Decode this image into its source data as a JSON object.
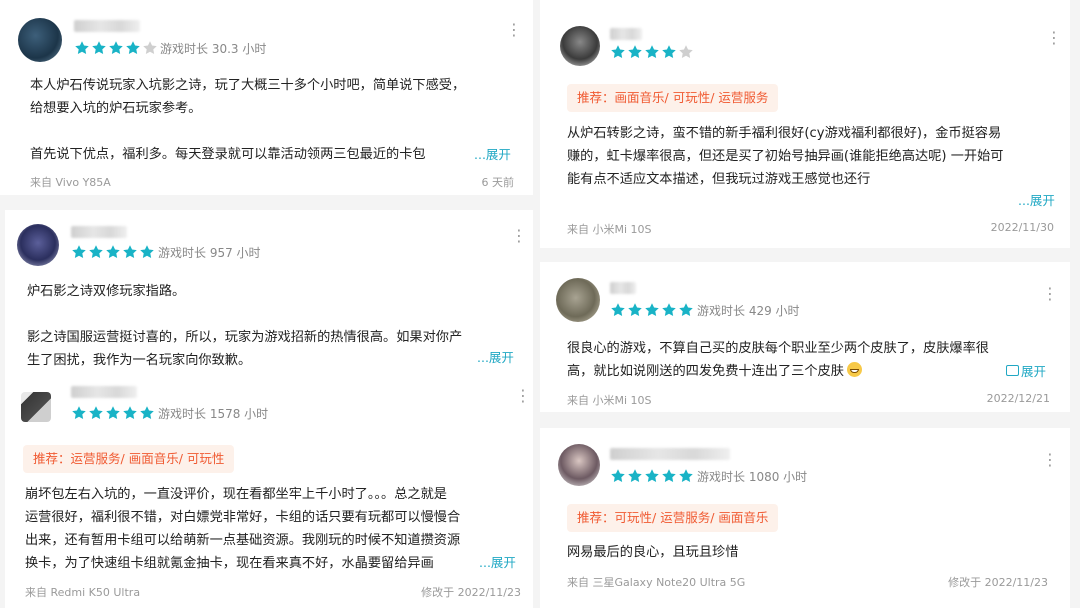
{
  "colors": {
    "star": "#19b3c6",
    "star_empty": "#cfcfcf",
    "link": "#21a8c4",
    "tag_bg": "#fdf1ea",
    "tag_text": "#f05a32"
  },
  "icons": {
    "star": "star-icon",
    "more": "more-vertical-icon",
    "image": "image-icon",
    "emoji": "grin-emoji-icon"
  },
  "reviews": [
    {
      "rating": 4,
      "playtime": "游戏时长 30.3 小时",
      "lines": [
        "本人炉石传说玩家入坑影之诗，玩了大概三十多个小时吧，简单说下感受，",
        "给想要入坑的炉石玩家参考。",
        "",
        "首先说下优点，福利多。每天登录就可以靠活动领两三包最近的卡包"
      ],
      "expand": "...展开",
      "device": "来自 Vivo Y85A",
      "date": "6 天前"
    },
    {
      "rating": 5,
      "playtime": "游戏时长 957 小时",
      "lines": [
        "炉石影之诗双修玩家指路。",
        "",
        "影之诗国服运营挺讨喜的，所以，玩家为游戏招新的热情很高。如果对你产",
        "生了困扰，我作为一名玩家向你致歉。"
      ],
      "expand": "...展开"
    },
    {
      "rating": 5,
      "playtime": "游戏时长 1578 小时",
      "tag_label": "推荐：",
      "tag_value": "运营服务/ 画面音乐/ 可玩性",
      "lines": [
        "崩坏包左右入坑的，一直没评价，现在看都坐牢上千小时了。。。总之就是",
        "运营很好，福利很不错，对白嫖党非常好，卡组的话只要有玩都可以慢慢合",
        "出来，还有暂用卡组可以给萌新一点基础资源。我刚玩的时候不知道攒资源",
        "换卡，为了快速组卡组就氪金抽卡，现在看来真不好，水晶要留给异画"
      ],
      "expand": "...展开",
      "device": "来自 Redmi K50 Ultra",
      "date": "修改于 2022/11/23"
    },
    {
      "rating": 4,
      "tag_label": "推荐：",
      "tag_value": "画面音乐/ 可玩性/ 运营服务",
      "lines": [
        "从炉石转影之诗，蛮不错的新手福利很好(cy游戏福利都很好)，金币挺容易",
        "赚的，虹卡爆率很高，但还是买了初始号抽异画(谁能拒绝高达呢) 一开始可",
        "能有点不适应文本描述，但我玩过游戏王感觉也还行"
      ],
      "expand": "...展开",
      "device": "来自 小米Mi 10S",
      "date": "2022/11/30"
    },
    {
      "rating": 5,
      "playtime": "游戏时长 429 小时",
      "lines": [
        "很良心的游戏，不算自己买的皮肤每个职业至少两个皮肤了，皮肤爆率很",
        "高，就比如说刚送的四发免费十连出了三个皮肤"
      ],
      "expand": "展开",
      "device": "来自 小米Mi 10S",
      "date": "2022/12/21"
    },
    {
      "rating": 5,
      "playtime": "游戏时长 1080 小时",
      "tag_label": "推荐：",
      "tag_value": "可玩性/ 运营服务/ 画面音乐",
      "lines": [
        "网易最后的良心，且玩且珍惜"
      ],
      "device": "来自 三星Galaxy Note20 Ultra 5G",
      "date": "修改于 2022/11/23"
    }
  ]
}
